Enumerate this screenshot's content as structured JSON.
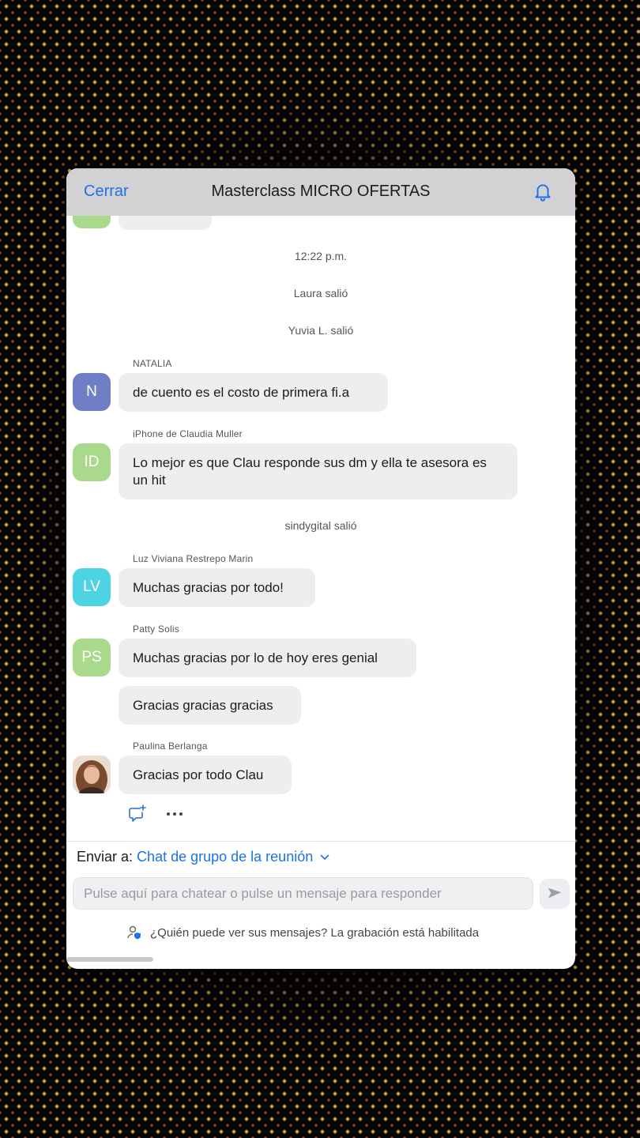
{
  "header": {
    "close_label": "Cerrar",
    "title": "Masterclass MICRO OFERTAS",
    "bell_icon": "bell-icon"
  },
  "system_messages": {
    "time": "12:22 p.m.",
    "laura": "Laura salió",
    "yuvia": "Yuvia L. salió",
    "sindygital": "sindygital salió"
  },
  "messages": [
    {
      "sender": "NATALIA",
      "initials": "N",
      "color": "#6f7fc6",
      "text": "de cuento es el costo de primera fi.a"
    },
    {
      "sender": "iPhone de Claudia Muller",
      "initials": "ID",
      "color": "#a9d98a",
      "text": "Lo mejor es que Clau responde sus dm y ella te asesora es un hit"
    },
    {
      "sender": "Luz Viviana Restrepo Marin",
      "initials": "LV",
      "color": "#4ed3e3",
      "text": "Muchas gracias por todo!"
    },
    {
      "sender": "Patty Solis",
      "initials": "PS",
      "color": "#a9d98a",
      "text": "Muchas gracias por lo de hoy eres genial"
    },
    {
      "sender": "",
      "initials": "",
      "color": "",
      "text": "Gracias gracias gracias"
    },
    {
      "sender": "Paulina Berlanga",
      "initials": "",
      "color": "",
      "text": "Gracias por todo Clau"
    }
  ],
  "actions": {
    "reply_icon": "add-reply-icon",
    "more_icon": "more-icon"
  },
  "composer": {
    "send_to_label": "Enviar a:",
    "send_to_target": "Chat de grupo de la reunión",
    "placeholder": "Pulse aquí para chatear o pulse un mensaje para responder",
    "privacy_text": "¿Quién puede ver sus mensajes? La grabación está habilitada"
  },
  "colors": {
    "accent": "#1a73e8",
    "bubble": "#eeeef0",
    "header": "#d2d2d4"
  }
}
